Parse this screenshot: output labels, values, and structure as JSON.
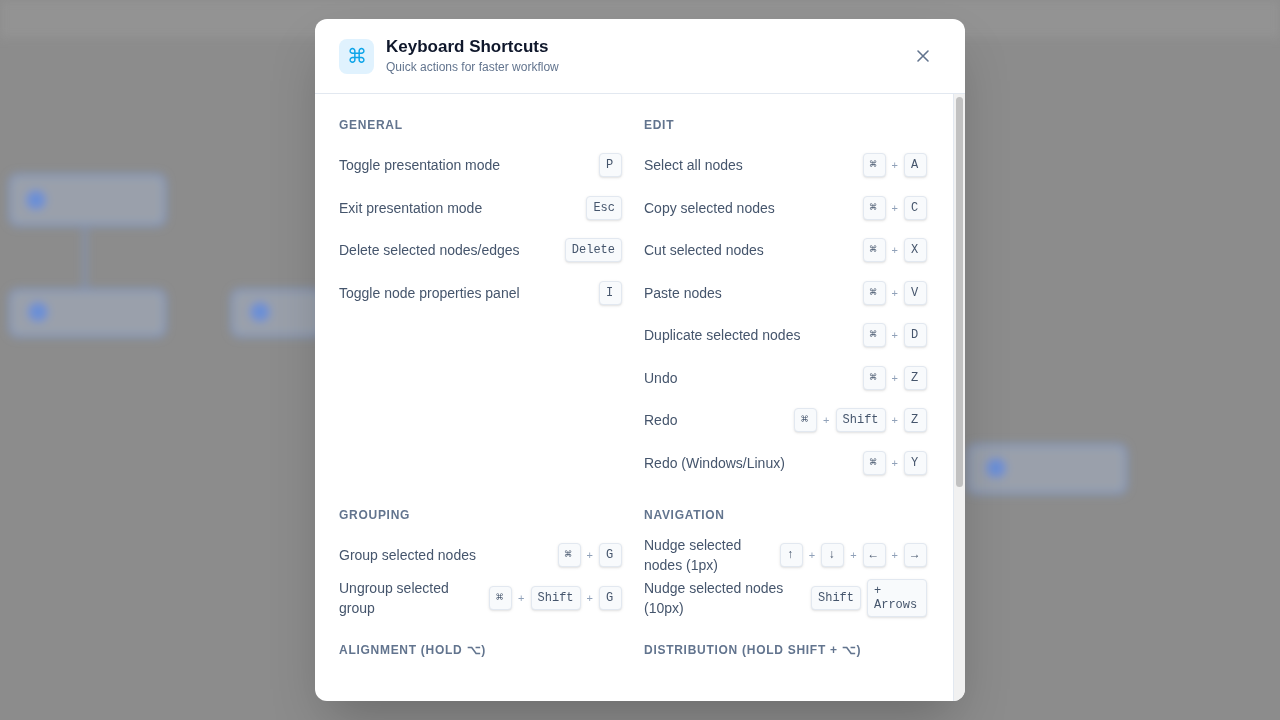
{
  "dialog": {
    "icon_glyph": "⌘",
    "title": "Keyboard Shortcuts",
    "subtitle": "Quick actions for faster workflow"
  },
  "sections": [
    {
      "title": "GENERAL",
      "items": [
        {
          "label": "Toggle presentation mode",
          "keys": [
            {
              "kind": "key",
              "text": "P"
            }
          ]
        },
        {
          "label": "Exit presentation mode",
          "keys": [
            {
              "kind": "key",
              "text": "Esc"
            }
          ]
        },
        {
          "label": "Delete selected nodes/edges",
          "keys": [
            {
              "kind": "key",
              "text": "Delete"
            }
          ]
        },
        {
          "label": "Toggle node properties panel",
          "keys": [
            {
              "kind": "key",
              "text": "I"
            }
          ]
        }
      ]
    },
    {
      "title": "EDIT",
      "items": [
        {
          "label": "Select all nodes",
          "keys": [
            {
              "kind": "key",
              "text": "⌘"
            },
            {
              "kind": "plus",
              "text": "+"
            },
            {
              "kind": "key",
              "text": "A"
            }
          ]
        },
        {
          "label": "Copy selected nodes",
          "keys": [
            {
              "kind": "key",
              "text": "⌘"
            },
            {
              "kind": "plus",
              "text": "+"
            },
            {
              "kind": "key",
              "text": "C"
            }
          ]
        },
        {
          "label": "Cut selected nodes",
          "keys": [
            {
              "kind": "key",
              "text": "⌘"
            },
            {
              "kind": "plus",
              "text": "+"
            },
            {
              "kind": "key",
              "text": "X"
            }
          ]
        },
        {
          "label": "Paste nodes",
          "keys": [
            {
              "kind": "key",
              "text": "⌘"
            },
            {
              "kind": "plus",
              "text": "+"
            },
            {
              "kind": "key",
              "text": "V"
            }
          ]
        },
        {
          "label": "Duplicate selected nodes",
          "keys": [
            {
              "kind": "key",
              "text": "⌘"
            },
            {
              "kind": "plus",
              "text": "+"
            },
            {
              "kind": "key",
              "text": "D"
            }
          ]
        },
        {
          "label": "Undo",
          "keys": [
            {
              "kind": "key",
              "text": "⌘"
            },
            {
              "kind": "plus",
              "text": "+"
            },
            {
              "kind": "key",
              "text": "Z"
            }
          ]
        },
        {
          "label": "Redo",
          "keys": [
            {
              "kind": "key",
              "text": "⌘"
            },
            {
              "kind": "plus",
              "text": "+"
            },
            {
              "kind": "key",
              "text": "Shift"
            },
            {
              "kind": "plus",
              "text": "+"
            },
            {
              "kind": "key",
              "text": "Z"
            }
          ]
        },
        {
          "label": "Redo (Windows/Linux)",
          "keys": [
            {
              "kind": "key",
              "text": "⌘"
            },
            {
              "kind": "plus",
              "text": "+"
            },
            {
              "kind": "key",
              "text": "Y"
            }
          ]
        }
      ]
    },
    {
      "title": "GROUPING",
      "items": [
        {
          "label": "Group selected nodes",
          "keys": [
            {
              "kind": "key",
              "text": "⌘"
            },
            {
              "kind": "plus",
              "text": "+"
            },
            {
              "kind": "key",
              "text": "G"
            }
          ]
        },
        {
          "label": "Ungroup selected group",
          "keys": [
            {
              "kind": "key",
              "text": "⌘"
            },
            {
              "kind": "plus",
              "text": "+"
            },
            {
              "kind": "key",
              "text": "Shift"
            },
            {
              "kind": "plus",
              "text": "+"
            },
            {
              "kind": "key",
              "text": "G"
            }
          ]
        }
      ]
    },
    {
      "title": "NAVIGATION",
      "items": [
        {
          "label": "Nudge selected nodes (1px)",
          "keys": [
            {
              "kind": "key",
              "text": "↑"
            },
            {
              "kind": "plus",
              "text": "+"
            },
            {
              "kind": "key",
              "text": "↓"
            },
            {
              "kind": "plus",
              "text": "+"
            },
            {
              "kind": "key",
              "text": "←"
            },
            {
              "kind": "plus",
              "text": "+"
            },
            {
              "kind": "key",
              "text": "→"
            }
          ]
        },
        {
          "label": "Nudge selected nodes (10px)",
          "keys": [
            {
              "kind": "key",
              "text": "Shift"
            },
            {
              "kind": "key",
              "text": "+ Arrows"
            }
          ]
        }
      ]
    },
    {
      "title": "ALIGNMENT (HOLD ⌥)"
    },
    {
      "title": "DISTRIBUTION (HOLD SHIFT + ⌥)"
    }
  ]
}
